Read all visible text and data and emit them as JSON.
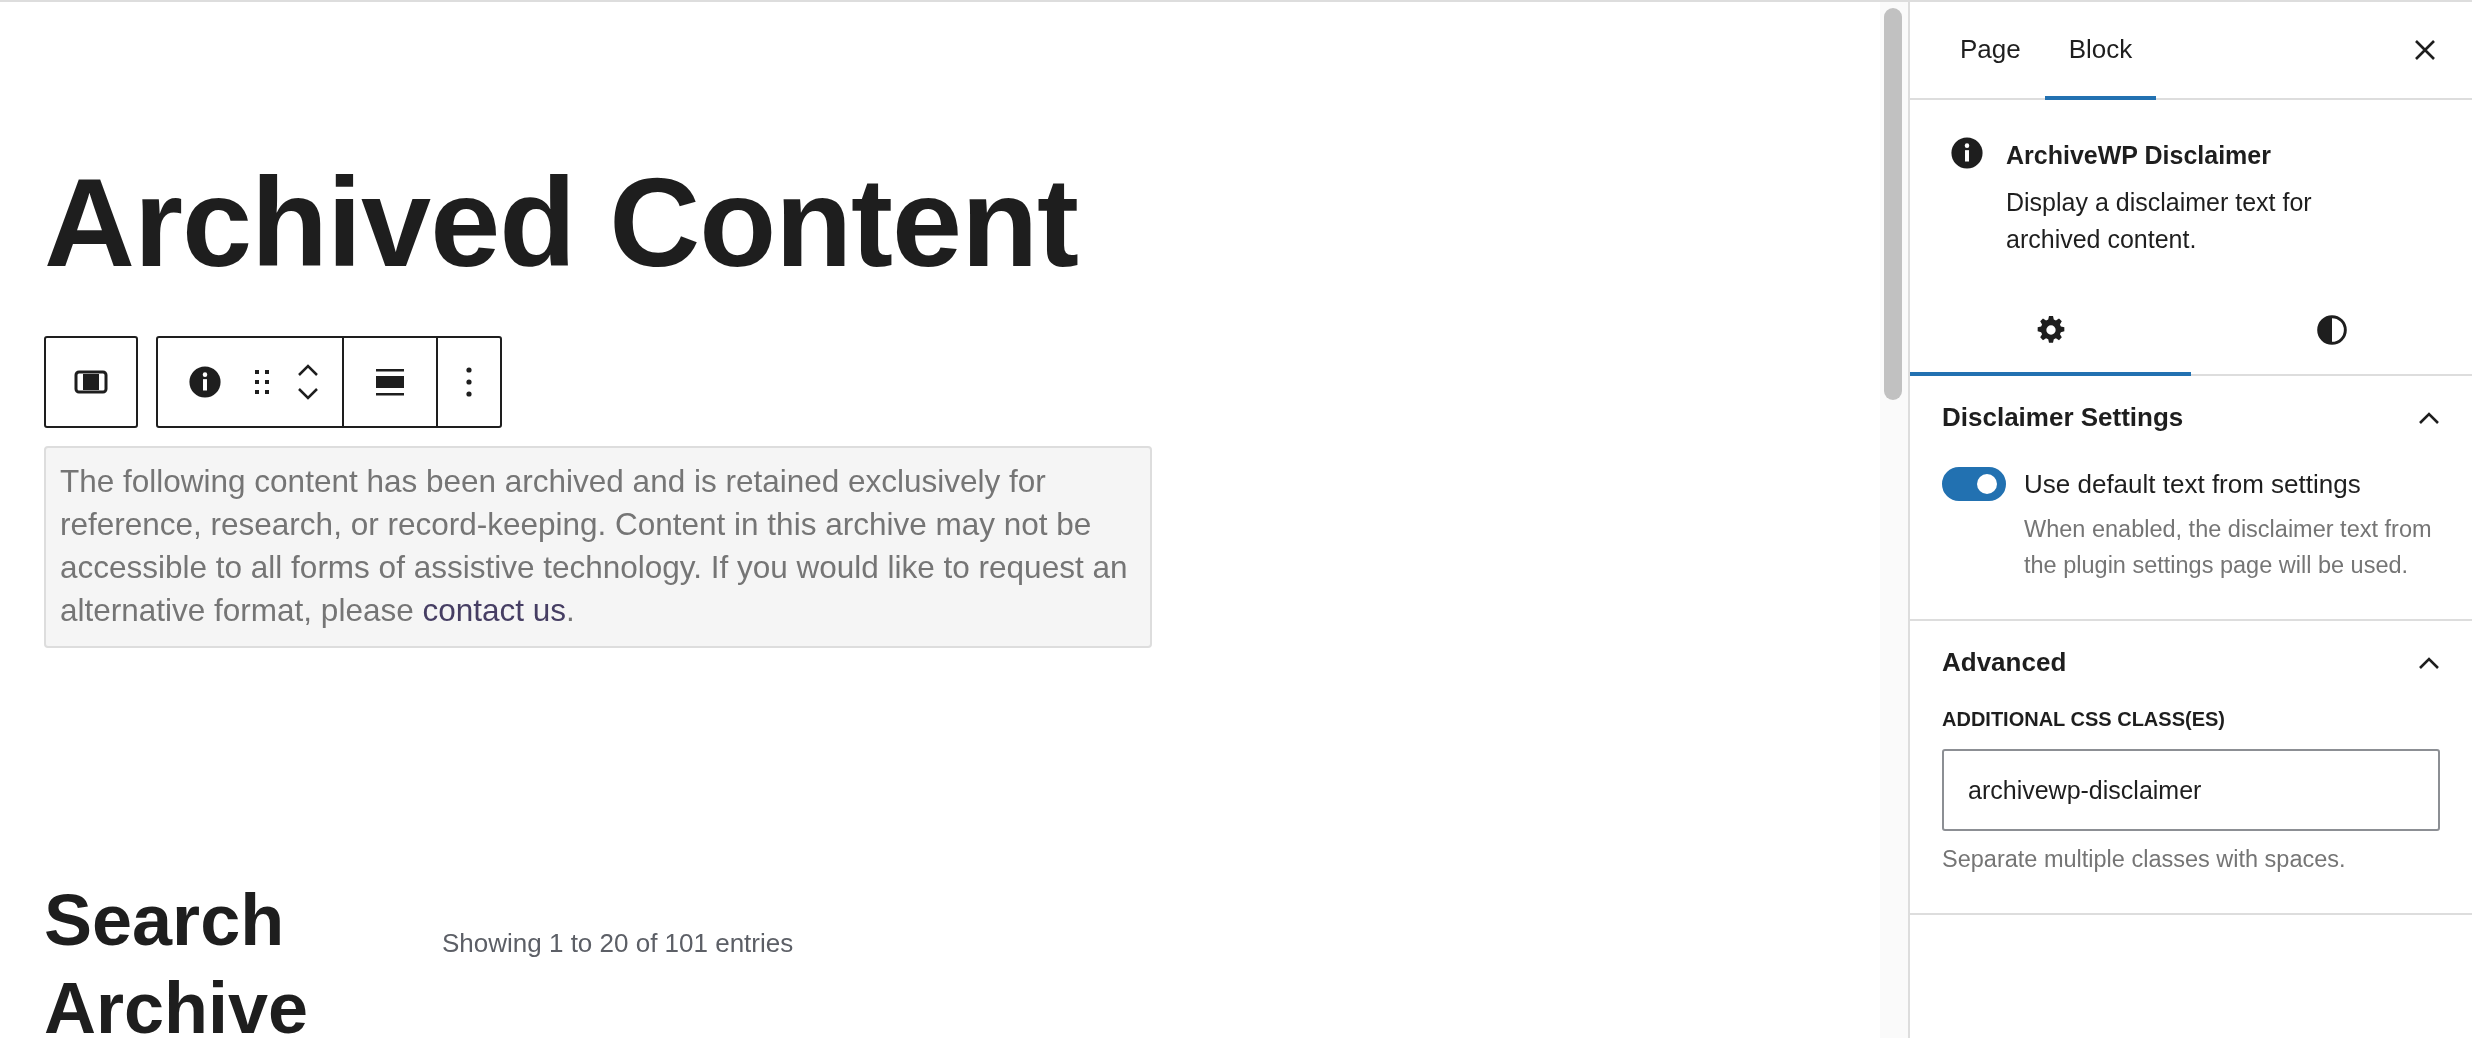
{
  "editor": {
    "title": "Archived Content",
    "toolbar": {
      "groups": [
        [
          {
            "kind": "block-type"
          }
        ],
        [
          {
            "kind": "info"
          },
          {
            "kind": "drag"
          },
          {
            "kind": "move"
          },
          {
            "kind": "align"
          },
          {
            "kind": "more"
          }
        ]
      ]
    },
    "disclaimer": {
      "text": "The following content has been archived and is retained exclusively for reference, research, or record-keeping. Content in this archive may not be accessible to all forms of assistive technology. If you would like to request an alternative format, please ",
      "link": "contact us",
      "after": "."
    },
    "search_heading": "Search Archive",
    "entries_info": "Showing 1 to 20 of 101 entries"
  },
  "sidebar": {
    "tabs": [
      {
        "label": "Page",
        "selected": false
      },
      {
        "label": "Block",
        "selected": true
      }
    ],
    "block": {
      "name": "ArchiveWP Disclaimer",
      "description": "Display a disclaimer text for archived content."
    },
    "subtabs": [
      {
        "kind": "settings",
        "selected": true
      },
      {
        "kind": "styles",
        "selected": false
      }
    ],
    "panels": [
      {
        "title": "Disclaimer Settings",
        "expanded": true,
        "kind": "toggle",
        "toggle": {
          "label": "Use default text from settings",
          "on": true,
          "help": "When enabled, the disclaimer text from the plugin settings page will be used."
        }
      },
      {
        "title": "Advanced",
        "expanded": true,
        "kind": "field",
        "field": {
          "label": "ADDITIONAL CSS CLASS(ES)",
          "value": "archivewp-disclaimer",
          "help": "Separate multiple classes with spaces."
        }
      }
    ]
  }
}
